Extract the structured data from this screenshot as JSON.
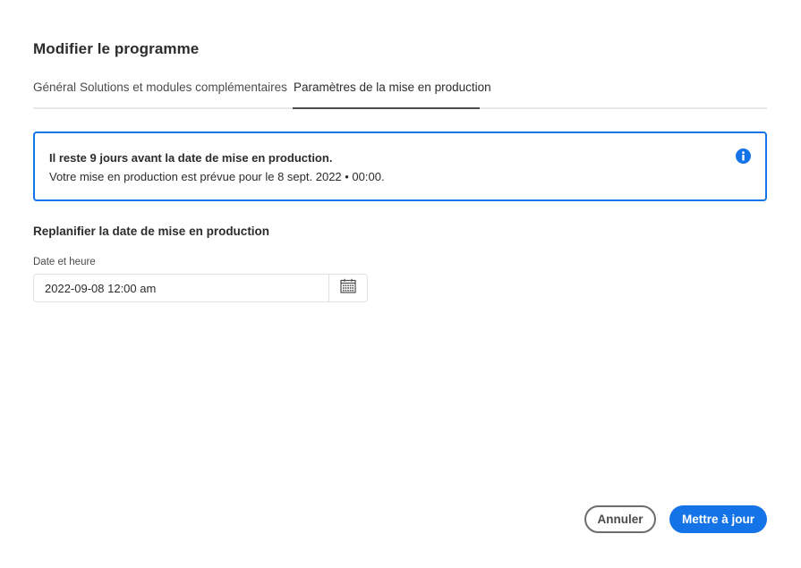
{
  "dialog": {
    "title": "Modifier le programme"
  },
  "tabs": [
    {
      "label": "Général"
    },
    {
      "label": "Solutions et modules complémentaires"
    },
    {
      "label": "Paramètres de la mise en production",
      "selected": true
    }
  ],
  "banner": {
    "heading": "Il reste 9 jours avant la date de mise en production.",
    "text": "Votre mise en production est prévue pour le 8 sept. 2022 • 00:00.",
    "icon": "info-icon",
    "accent_color": "#1473e6"
  },
  "reschedule": {
    "heading": "Replanifier la date de mise en production",
    "field_label": "Date et heure",
    "value": "2022-09-08 12:00 am",
    "calendar_icon": "calendar-icon"
  },
  "footer": {
    "cancel_label": "Annuler",
    "update_label": "Mettre à jour"
  },
  "colors": {
    "primary": "#1473e6",
    "text": "#2c2c2c",
    "border": "#e1e1e1"
  }
}
